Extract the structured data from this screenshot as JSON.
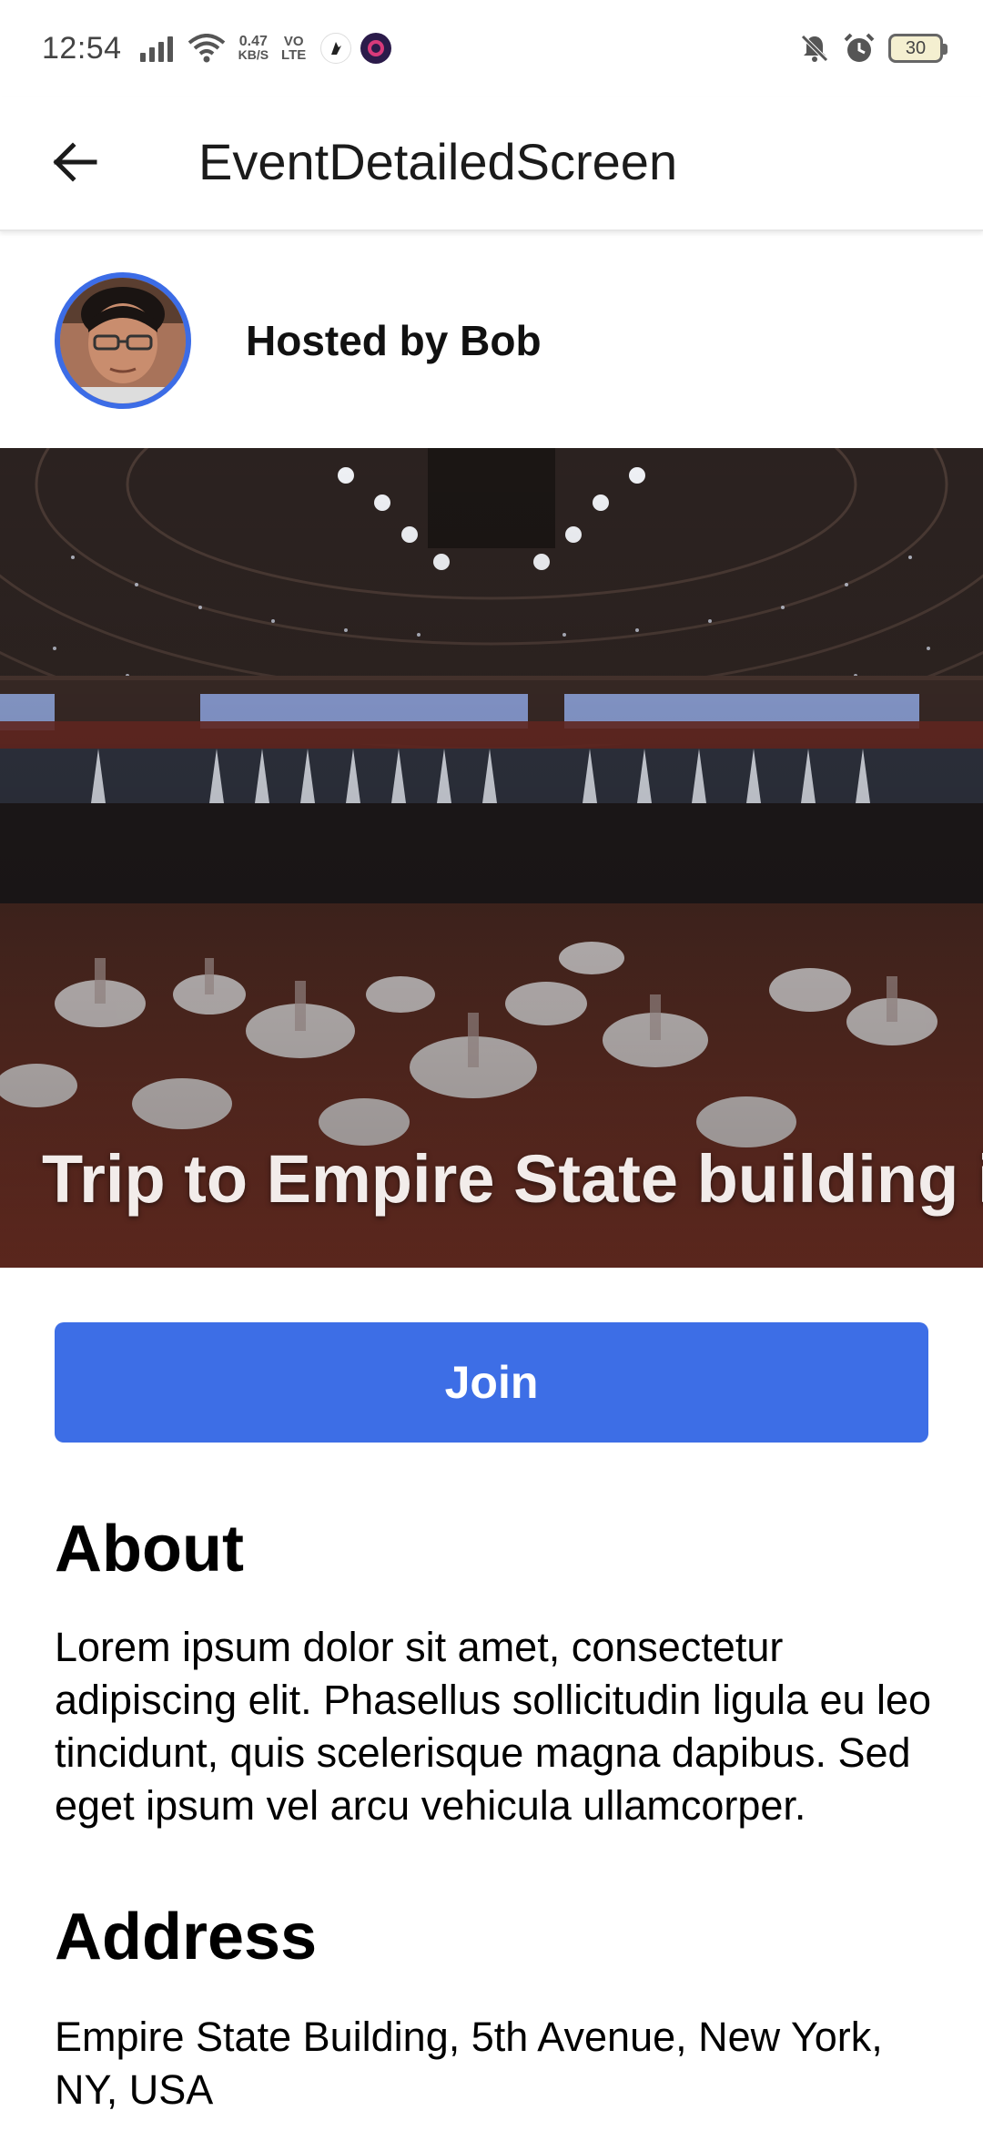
{
  "status_bar": {
    "time": "12:54",
    "speed_value": "0.47",
    "speed_unit": "KB/S",
    "volte_top": "VO",
    "volte_bottom": "LTE",
    "battery": "30"
  },
  "app_bar": {
    "title": "EventDetailedScreen",
    "back_icon": "arrow-left-icon"
  },
  "host": {
    "label": "Hosted by Bob"
  },
  "event": {
    "title": "Trip to Empire State building is"
  },
  "join_button": {
    "label": "Join",
    "color": "#3d6ee6"
  },
  "about": {
    "heading": "About",
    "text": "Lorem ipsum dolor sit amet, consectetur adipiscing elit. Phasellus sollicitudin ligula eu leo tincidunt, quis scelerisque magna dapibus. Sed eget ipsum vel arcu vehicula ullamcorper."
  },
  "address": {
    "heading": "Address",
    "text": "Empire State Building, 5th Avenue, New York, NY, USA"
  },
  "colors": {
    "accent": "#3d6ee6",
    "avatar_ring": "#3c6ce6"
  }
}
